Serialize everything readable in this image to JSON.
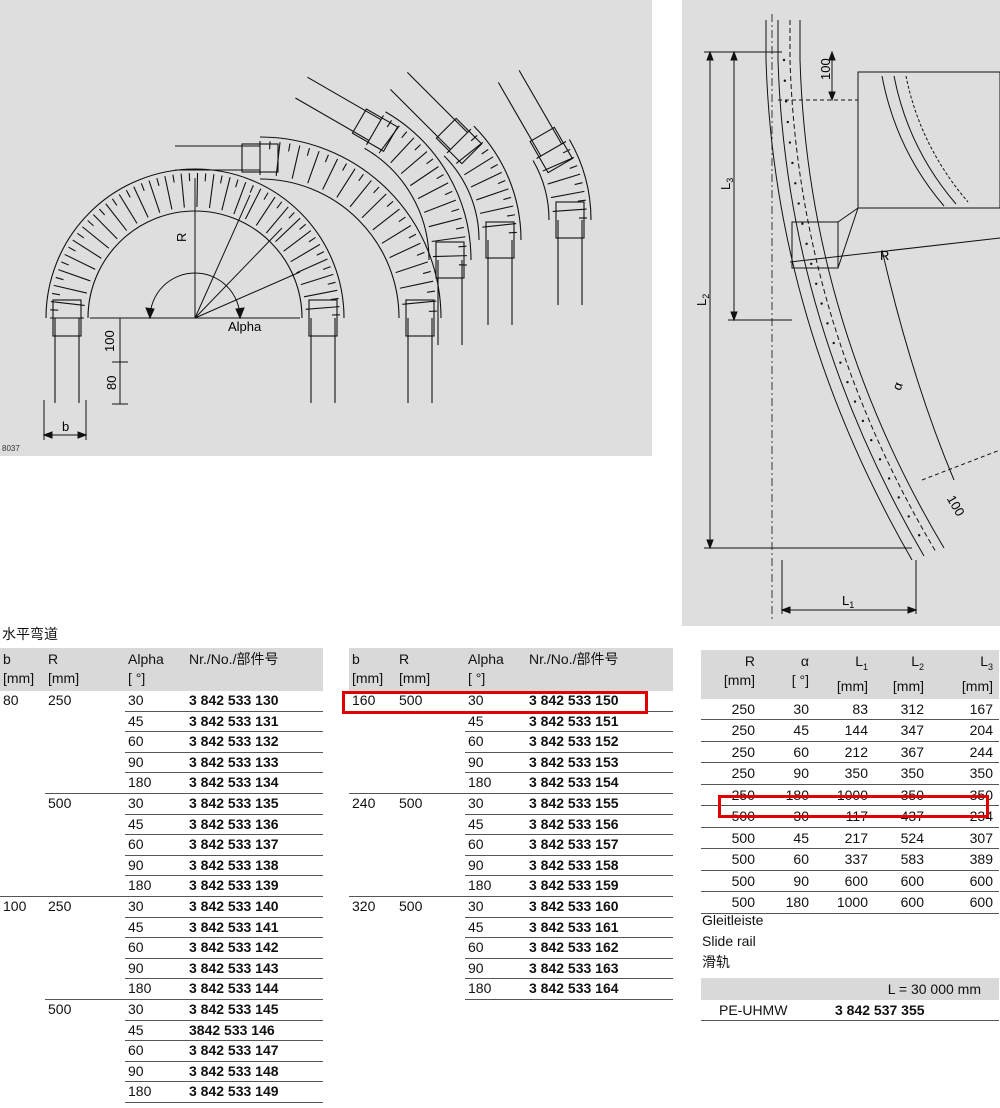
{
  "figure_left": {
    "label_R": "R",
    "label_alpha": "Alpha",
    "label_100": "100",
    "label_80": "80",
    "label_b": "b",
    "code": "8037"
  },
  "figure_right": {
    "label_100_top": "100",
    "label_L3": "L",
    "label_L3_sub": "3",
    "label_L2": "L",
    "label_L2_sub": "2",
    "label_L1": "L",
    "label_L1_sub": "1",
    "label_R": "R",
    "label_alpha": "α",
    "label_100_bottom": "100"
  },
  "section_title": "水平弯道",
  "curve_headers": {
    "b": "b",
    "b_unit": "[mm]",
    "R": "R",
    "R_unit": "[mm]",
    "alpha": "Alpha",
    "alpha_unit": "[ °]",
    "nr": "Nr./No./部件号"
  },
  "curve_table_1": [
    {
      "b": "80",
      "R": "250",
      "a": "30",
      "nr": "3 842 533 130"
    },
    {
      "b": "",
      "R": "",
      "a": "45",
      "nr": "3 842 533 131"
    },
    {
      "b": "",
      "R": "",
      "a": "60",
      "nr": "3 842 533 132"
    },
    {
      "b": "",
      "R": "",
      "a": "90",
      "nr": "3 842 533 133"
    },
    {
      "b": "",
      "R": "",
      "a": "180",
      "nr": "3 842 533 134"
    },
    {
      "b": "",
      "R": "500",
      "a": "30",
      "nr": "3 842 533 135"
    },
    {
      "b": "",
      "R": "",
      "a": "45",
      "nr": "3 842 533 136"
    },
    {
      "b": "",
      "R": "",
      "a": "60",
      "nr": "3 842 533 137"
    },
    {
      "b": "",
      "R": "",
      "a": "90",
      "nr": "3 842 533 138"
    },
    {
      "b": "",
      "R": "",
      "a": "180",
      "nr": "3 842 533 139"
    },
    {
      "b": "100",
      "R": "250",
      "a": "30",
      "nr": "3 842 533 140"
    },
    {
      "b": "",
      "R": "",
      "a": "45",
      "nr": "3 842 533 141"
    },
    {
      "b": "",
      "R": "",
      "a": "60",
      "nr": "3 842 533 142"
    },
    {
      "b": "",
      "R": "",
      "a": "90",
      "nr": "3 842 533 143"
    },
    {
      "b": "",
      "R": "",
      "a": "180",
      "nr": "3 842 533 144"
    },
    {
      "b": "",
      "R": "500",
      "a": "30",
      "nr": "3 842 533 145"
    },
    {
      "b": "",
      "R": "",
      "a": "45",
      "nr": "3842 533 146"
    },
    {
      "b": "",
      "R": "",
      "a": "60",
      "nr": "3 842 533 147"
    },
    {
      "b": "",
      "R": "",
      "a": "90",
      "nr": "3 842 533 148"
    },
    {
      "b": "",
      "R": "",
      "a": "180",
      "nr": "3 842 533 149"
    }
  ],
  "curve_table_2": [
    {
      "b": "160",
      "R": "500",
      "a": "30",
      "nr": "3 842 533 150"
    },
    {
      "b": "",
      "R": "",
      "a": "45",
      "nr": "3 842 533 151"
    },
    {
      "b": "",
      "R": "",
      "a": "60",
      "nr": "3 842 533 152"
    },
    {
      "b": "",
      "R": "",
      "a": "90",
      "nr": "3 842 533 153"
    },
    {
      "b": "",
      "R": "",
      "a": "180",
      "nr": "3 842 533 154"
    },
    {
      "b": "240",
      "R": "500",
      "a": "30",
      "nr": "3 842 533 155"
    },
    {
      "b": "",
      "R": "",
      "a": "45",
      "nr": "3 842 533 156"
    },
    {
      "b": "",
      "R": "",
      "a": "60",
      "nr": "3 842 533 157"
    },
    {
      "b": "",
      "R": "",
      "a": "90",
      "nr": "3 842 533 158"
    },
    {
      "b": "",
      "R": "",
      "a": "180",
      "nr": "3 842 533 159"
    },
    {
      "b": "320",
      "R": "500",
      "a": "30",
      "nr": "3 842 533 160"
    },
    {
      "b": "",
      "R": "",
      "a": "45",
      "nr": "3 842 533 161"
    },
    {
      "b": "",
      "R": "",
      "a": "60",
      "nr": "3 842 533 162"
    },
    {
      "b": "",
      "R": "",
      "a": "90",
      "nr": "3 842 533 163"
    },
    {
      "b": "",
      "R": "",
      "a": "180",
      "nr": "3 842 533 164"
    }
  ],
  "dims_headers": {
    "R": "R",
    "R_unit": "[mm]",
    "a": "α",
    "a_unit": "[ °]",
    "L1": "L",
    "L1_sub": "1",
    "L1_unit": "[mm]",
    "L2": "L",
    "L2_sub": "2",
    "L2_unit": "[mm]",
    "L3": "L",
    "L3_sub": "3",
    "L3_unit": "[mm]"
  },
  "dims_table": [
    [
      "250",
      "30",
      "83",
      "312",
      "167"
    ],
    [
      "250",
      "45",
      "144",
      "347",
      "204"
    ],
    [
      "250",
      "60",
      "212",
      "367",
      "244"
    ],
    [
      "250",
      "90",
      "350",
      "350",
      "350"
    ],
    [
      "250",
      "180",
      "1000",
      "350",
      "350"
    ],
    [
      "500",
      "30",
      "117",
      "437",
      "234"
    ],
    [
      "500",
      "45",
      "217",
      "524",
      "307"
    ],
    [
      "500",
      "60",
      "337",
      "583",
      "389"
    ],
    [
      "500",
      "90",
      "600",
      "600",
      "600"
    ],
    [
      "500",
      "180",
      "1000",
      "600",
      "600"
    ]
  ],
  "highlight_colour": "#e00000",
  "slide_rail": {
    "title_de": "Gleitleiste",
    "title_en": "Slide rail",
    "title_cn": "滑轨",
    "length": "L = 30 000 mm",
    "material": "PE-UHMW",
    "nr": "3 842 537 355"
  }
}
